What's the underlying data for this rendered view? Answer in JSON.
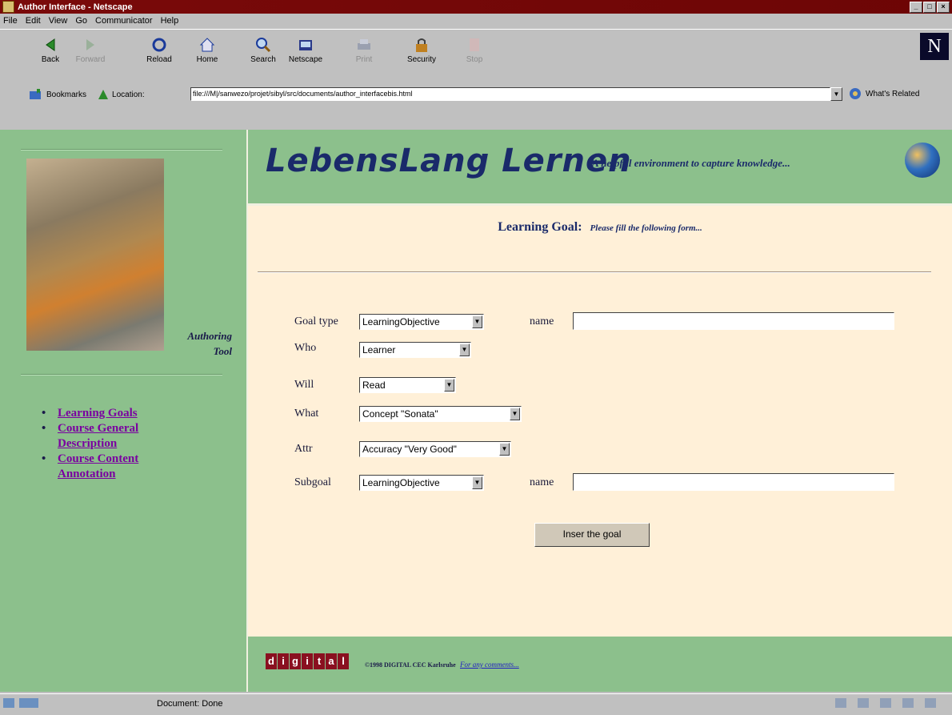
{
  "window": {
    "title": "Author Interface - Netscape"
  },
  "menu": [
    "File",
    "Edit",
    "View",
    "Go",
    "Communicator",
    "Help"
  ],
  "toolbar": [
    {
      "label": "Back",
      "icon": "back-arrow-icon",
      "enabled": true
    },
    {
      "label": "Forward",
      "icon": "forward-arrow-icon",
      "enabled": false
    },
    {
      "label": "Reload",
      "icon": "reload-icon",
      "enabled": true
    },
    {
      "label": "Home",
      "icon": "home-icon",
      "enabled": true
    },
    {
      "label": "Search",
      "icon": "search-icon",
      "enabled": true
    },
    {
      "label": "Netscape",
      "icon": "netscape-icon",
      "enabled": true
    },
    {
      "label": "Print",
      "icon": "print-icon",
      "enabled": false
    },
    {
      "label": "Security",
      "icon": "lock-icon",
      "enabled": true
    },
    {
      "label": "Stop",
      "icon": "stop-icon",
      "enabled": false
    }
  ],
  "location": {
    "bookmarks_label": "Bookmarks",
    "location_label": "Location:",
    "url": "file:///M|/sanwezo/projet/sibyl/src/documents/author_interfacebis.html",
    "related_label": "What's Related"
  },
  "sidebar": {
    "authoring_tool": [
      "Authoring",
      "Tool"
    ],
    "links": [
      "Learning Goals",
      "Course General Description",
      "Course Content Annotation"
    ]
  },
  "header": {
    "brand": "LebensLang Lernen",
    "tagline": "A helpful environment to capture knowledge..."
  },
  "form": {
    "heading": "Learning Goal:",
    "subheading": "Please fill the following form...",
    "goal_type_label": "Goal type",
    "goal_type_value": "LearningObjective",
    "name_label": "name",
    "who_label": "Who",
    "who_value": "Learner",
    "will_label": "Will",
    "will_value": "Read",
    "what_label": "What",
    "what_value": "Concept \"Sonata\"",
    "attr_label": "Attr",
    "attr_value": "Accuracy \"Very Good\"",
    "subgoal_label": "Subgoal",
    "subgoal_value": "LearningObjective",
    "subgoal_name_label": "name",
    "submit_label": "Inser the goal"
  },
  "footer": {
    "logo_letters": [
      "d",
      "i",
      "g",
      "i",
      "t",
      "a",
      "l"
    ],
    "copyright": "©1998 DIGITAL CEC Karlsruhe",
    "comments_link": "For any comments..."
  },
  "status": {
    "text": "Document: Done"
  },
  "colors": {
    "panel_green": "#8cc08c",
    "form_bg": "#fff0d8",
    "title_bar": "#7a0a0a",
    "link_purple": "#7a00a0"
  }
}
